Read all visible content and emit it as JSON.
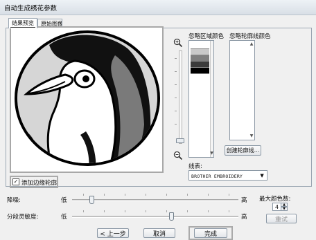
{
  "window": {
    "title": "自动生成绣花参数"
  },
  "tabs": [
    {
      "label": "结果预览"
    },
    {
      "label": "原始图像"
    }
  ],
  "palette": {
    "ignore_region_label": "忽略区域颜色",
    "ignore_outline_label": "忽略轮廓线颜色",
    "colors": [
      "#ffffff",
      "#c9c9c9",
      "#7f7f7f",
      "#3b3b3b",
      "#000000"
    ],
    "create_outline_button": "创建轮廓线...",
    "thread_label": "线表:",
    "thread_value": "BROTHER EMBROIDERY"
  },
  "outline_checkbox": {
    "label": "添加边缘轮廓",
    "checked": true,
    "mark": "✓"
  },
  "noise": {
    "label": "降噪:",
    "low": "低",
    "high": "高",
    "level": 0.12
  },
  "sensitivity": {
    "label": "分段灵敏度:",
    "low": "低",
    "high": "高",
    "level": 0.6
  },
  "max_colors": {
    "label": "最大颜色数:",
    "value": "4",
    "reset_button": "重试"
  },
  "buttons": {
    "back": "< 上一步",
    "cancel": "取消",
    "finish": "完成"
  }
}
